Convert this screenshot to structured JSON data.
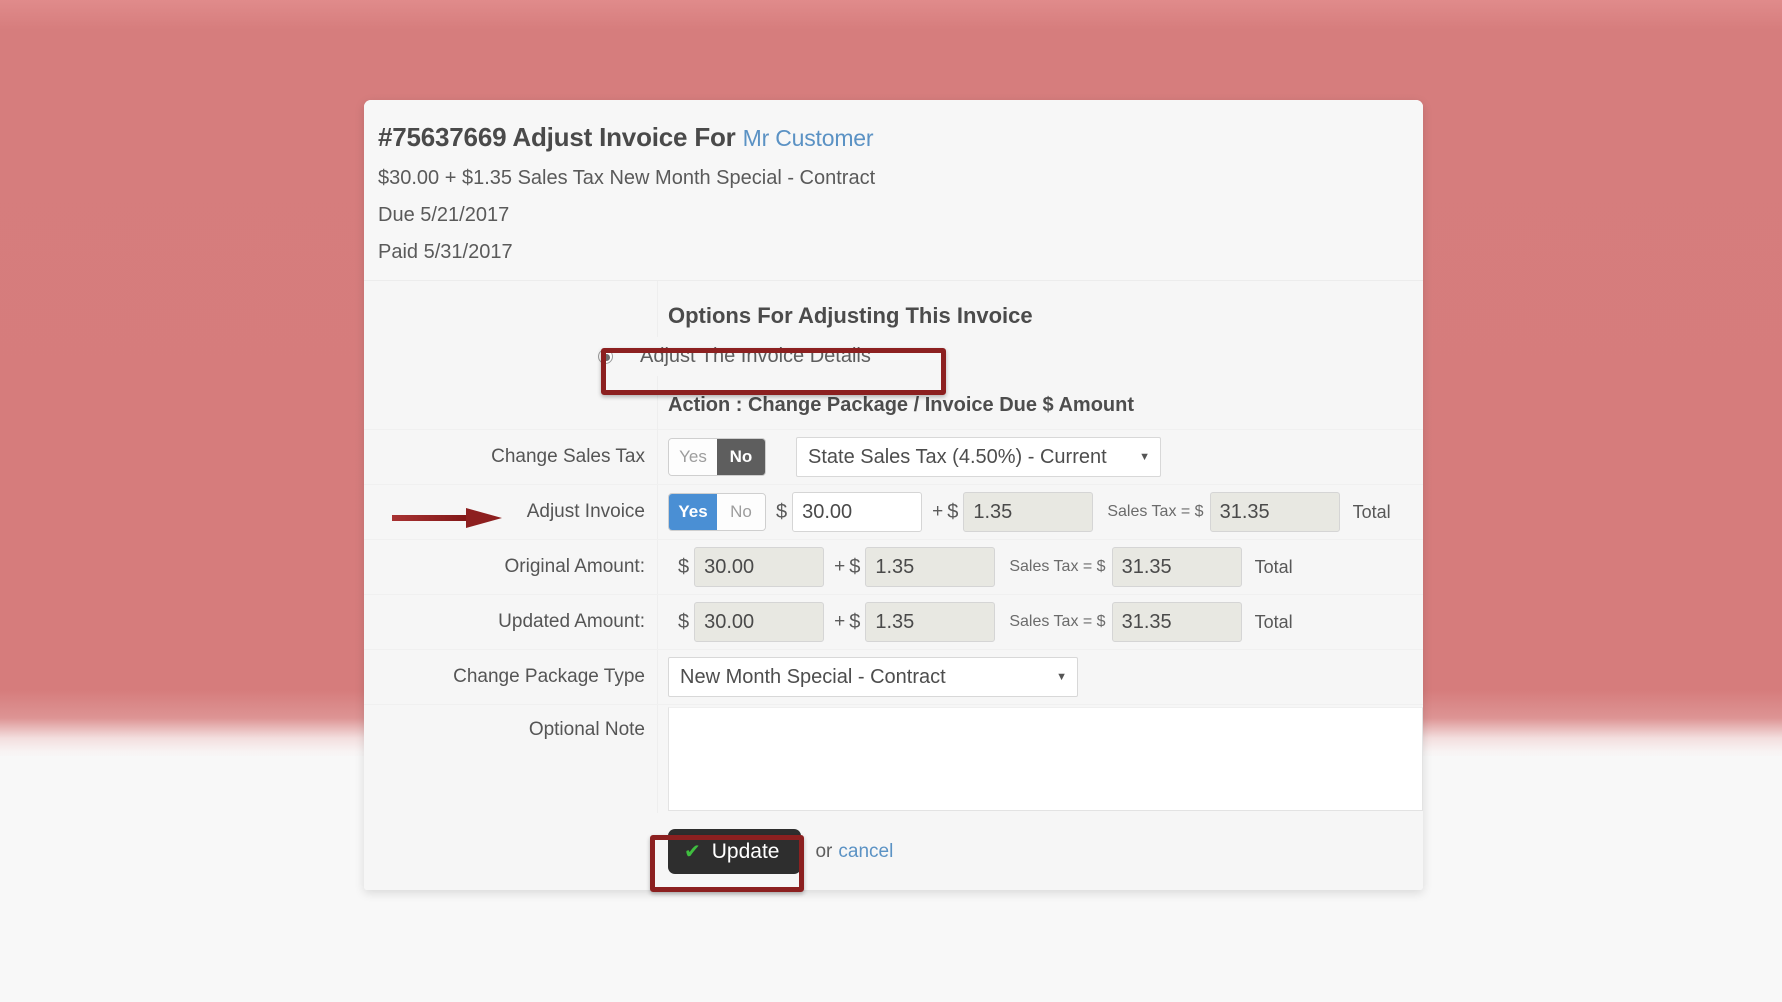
{
  "invoice": {
    "number": "#75637669",
    "title_prefix": "#75637669 Adjust Invoice For",
    "customer": "Mr Customer",
    "summary": "$30.00 + $1.35 Sales Tax New Month Special - Contract",
    "due": "Due 5/21/2017",
    "paid": "Paid 5/31/2017"
  },
  "options": {
    "section_title": "Options For Adjusting This Invoice",
    "radio_label": "Adjust The Invoice Details",
    "radio_selected": true,
    "action_line": "Action : Change Package / Invoice Due $ Amount"
  },
  "rows": {
    "change_sales_tax": {
      "label": "Change Sales Tax",
      "yes": "Yes",
      "no": "No",
      "selected": "No",
      "select_value": "State Sales Tax (4.50%) - Current"
    },
    "adjust_invoice": {
      "label": "Adjust Invoice",
      "yes": "Yes",
      "no": "No",
      "selected": "Yes",
      "dollar": "$",
      "amount": "30.00",
      "plus": "+",
      "tax": "1.35",
      "sales_tax_label": "Sales Tax = $",
      "total": "31.35",
      "total_label": "Total"
    },
    "original_amount": {
      "label": "Original Amount:",
      "dollar": "$",
      "amount": "30.00",
      "plus": "+",
      "tax": "1.35",
      "sales_tax_label": "Sales Tax = $",
      "total": "31.35",
      "total_label": "Total"
    },
    "updated_amount": {
      "label": "Updated Amount:",
      "dollar": "$",
      "amount": "30.00",
      "plus": "+",
      "tax": "1.35",
      "sales_tax_label": "Sales Tax = $",
      "total": "31.35",
      "total_label": "Total"
    },
    "change_package_type": {
      "label": "Change Package Type",
      "select_value": "New Month Special - Contract"
    },
    "optional_note": {
      "label": "Optional Note",
      "value": "",
      "placeholder": ""
    }
  },
  "footer": {
    "update_label": "Update",
    "check_icon": "✔",
    "or_text": "or",
    "cancel_label": "cancel"
  },
  "colors": {
    "background": "#d67c7c",
    "accent_blue": "#4a8fd4",
    "annotation_red": "#8c2020",
    "toggle_dark": "#5e5e5e",
    "check_green": "#3fbe3f",
    "link_blue": "#5b92c4"
  }
}
